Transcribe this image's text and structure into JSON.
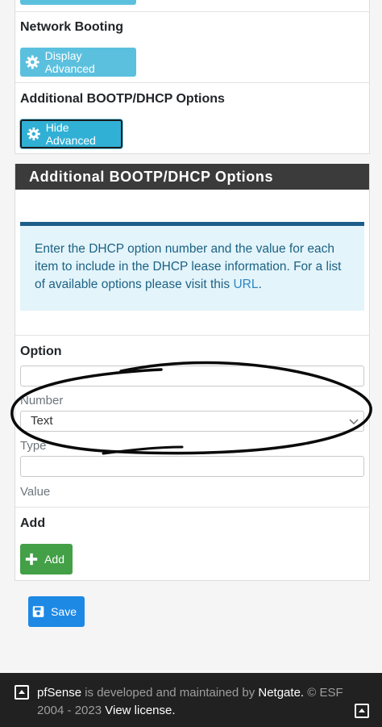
{
  "sections": {
    "network_booting": {
      "label": "Network Booting",
      "button": "Display Advanced"
    },
    "additional_options": {
      "label": "Additional BOOTP/DHCP Options",
      "button": "Hide Advanced"
    }
  },
  "panel": {
    "title": "Additional BOOTP/DHCP Options",
    "info_text": "Enter the DHCP option number and the value for each item to include in the DHCP lease information. For a list of available options please visit this",
    "info_link": "URL",
    "info_end": "."
  },
  "form": {
    "option_label": "Option",
    "number_label": "Number",
    "number_value": "",
    "type_label": "Type",
    "type_selected": "Text",
    "value_label": "Value",
    "value_value": "",
    "add_label": "Add",
    "add_button": "Add"
  },
  "save_button": "Save",
  "footer": {
    "brand": "pfSense",
    "text1": "is developed and maintained by",
    "company": "Netgate.",
    "copyright": "© ESF 2004 - 2023",
    "license_link": "View license."
  },
  "colors": {
    "info_button": "#5bc0de",
    "success_button": "#43a047",
    "primary_button": "#1e88e5",
    "panel_header": "#3b3b3b",
    "footer_bg": "#212121"
  }
}
